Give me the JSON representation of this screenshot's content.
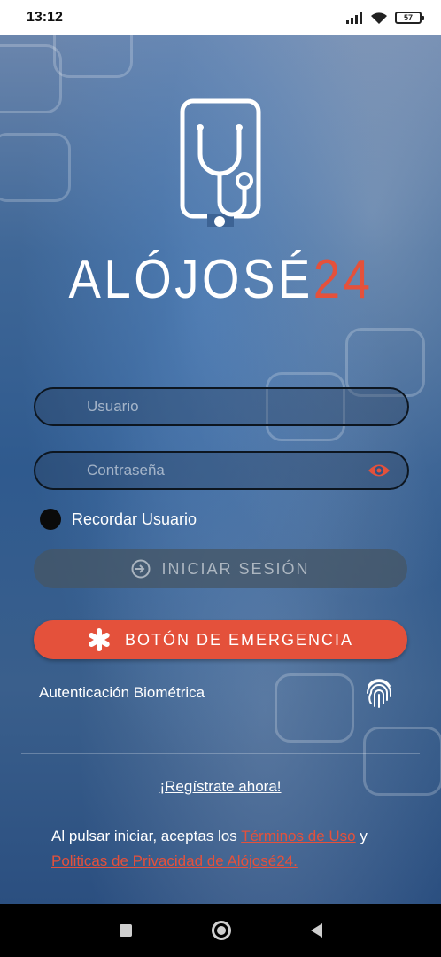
{
  "status_bar": {
    "time": "13:12",
    "battery": "57"
  },
  "app": {
    "brand_main": "ALÓJOSÉ",
    "brand_accent": "24",
    "accent_color": "#e4513b"
  },
  "login": {
    "username_placeholder": "Usuario",
    "password_placeholder": "Contraseña",
    "remember_label": "Recordar Usuario",
    "login_button": "INICIAR SESIÓN",
    "emergency_button": "BOTÓN DE EMERGENCIA",
    "biometric_label": "Autenticación Biométrica",
    "register_link": "¡Regístrate ahora!"
  },
  "terms": {
    "prefix": "Al pulsar iniciar, aceptas los ",
    "terms_link": "Términos de Uso",
    "connector": " y ",
    "privacy_link": "Politicas de Privacidad de Alójosé24."
  },
  "icons": {
    "stethoscope": "stethoscope-phone-icon",
    "eye": "eye-icon",
    "login": "login-arrow-icon",
    "emergency": "asterisk-icon",
    "fingerprint": "fingerprint-icon"
  }
}
